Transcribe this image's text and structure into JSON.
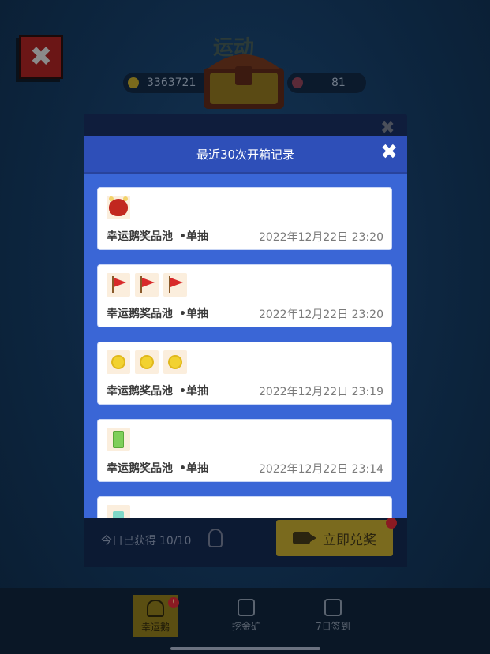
{
  "background": {
    "title": "运动",
    "coins": "3363721",
    "tickets": "81",
    "today_label": "今日已获得",
    "today_count": "10/10",
    "redeem_label": "立即兑奖"
  },
  "modal": {
    "title": "最近30次开箱记录",
    "close_icon": "close-icon",
    "records": [
      {
        "items": [
          "red-ox"
        ],
        "pool": "幸运鹅奖品池",
        "mode": "•单抽",
        "time": "2022年12月22日 23:20"
      },
      {
        "items": [
          "red-flag",
          "red-flag",
          "red-flag"
        ],
        "pool": "幸运鹅奖品池",
        "mode": "•单抽",
        "time": "2022年12月22日 23:20"
      },
      {
        "items": [
          "gold-coin",
          "gold-coin",
          "gold-coin"
        ],
        "pool": "幸运鹅奖品池",
        "mode": "•单抽",
        "time": "2022年12月22日 23:19"
      },
      {
        "items": [
          "green-ticket"
        ],
        "pool": "幸运鹅奖品池",
        "mode": "•单抽",
        "time": "2022年12月22日 23:14"
      },
      {
        "items": [
          "star-tile"
        ],
        "pool": "",
        "mode": "",
        "time": ""
      }
    ]
  },
  "bottom_nav": {
    "items": [
      {
        "label": "幸运鹅",
        "badge": "!"
      },
      {
        "label": "挖金矿"
      },
      {
        "label": "7日签到"
      }
    ]
  },
  "colors": {
    "modal_bg": "#3a66d6",
    "modal_header": "#2e4fb8",
    "card_bg": "#ffffff",
    "item_bg": "#fbeedd"
  }
}
